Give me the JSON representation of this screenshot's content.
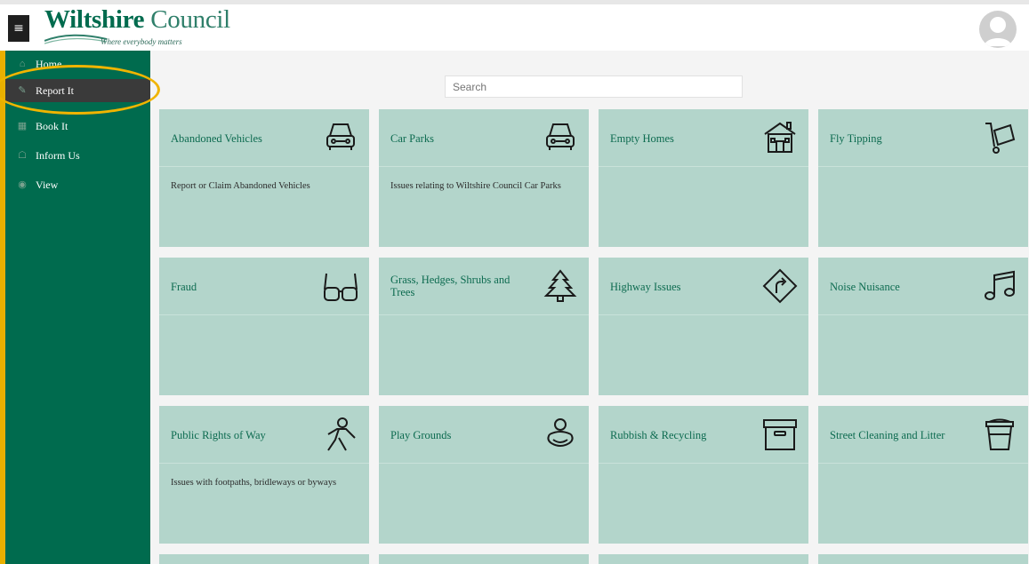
{
  "header": {
    "menu_glyph": "≡",
    "logo_word_1": "Wiltshire",
    "logo_word_2": "Council",
    "logo_tagline": "Where everybody matters"
  },
  "sidebar": {
    "items": [
      {
        "label": "Home",
        "icon": "home-icon"
      },
      {
        "label": "Report It",
        "icon": "report-icon"
      },
      {
        "label": "Book It",
        "icon": "calendar-icon"
      },
      {
        "label": "Inform Us",
        "icon": "chat-icon"
      },
      {
        "label": "View",
        "icon": "eye-icon"
      }
    ],
    "active_index": 1
  },
  "search": {
    "placeholder": "Search"
  },
  "tiles": [
    {
      "title": "Abandoned Vehicles",
      "desc": "Report or Claim Abandoned Vehicles",
      "icon": "car-icon"
    },
    {
      "title": "Car Parks",
      "desc": "Issues relating to Wiltshire Council Car Parks",
      "icon": "car-icon"
    },
    {
      "title": "Empty Homes",
      "desc": "",
      "icon": "house-icon"
    },
    {
      "title": "Fly Tipping",
      "desc": "",
      "icon": "cart-icon"
    },
    {
      "title": "Fraud",
      "desc": "",
      "icon": "glasses-icon"
    },
    {
      "title": "Grass, Hedges, Shrubs and Trees",
      "desc": "",
      "icon": "tree-icon"
    },
    {
      "title": "Highway Issues",
      "desc": "",
      "icon": "road-sign-icon"
    },
    {
      "title": "Noise Nuisance",
      "desc": "",
      "icon": "music-note-icon"
    },
    {
      "title": "Public Rights of Way",
      "desc": "Issues with footpaths, bridleways or byways",
      "icon": "walker-icon"
    },
    {
      "title": "Play Grounds",
      "desc": "",
      "icon": "baby-icon"
    },
    {
      "title": "Rubbish & Recycling",
      "desc": "",
      "icon": "storage-box-icon"
    },
    {
      "title": "Street Cleaning and Litter",
      "desc": "",
      "icon": "bin-icon"
    }
  ],
  "colors": {
    "sidebar": "#006b4e",
    "sidebar_active": "#3a3a3a",
    "tile": "#b3d5cb",
    "tile_title": "#0d6b50",
    "highlight": "#f0b400"
  }
}
